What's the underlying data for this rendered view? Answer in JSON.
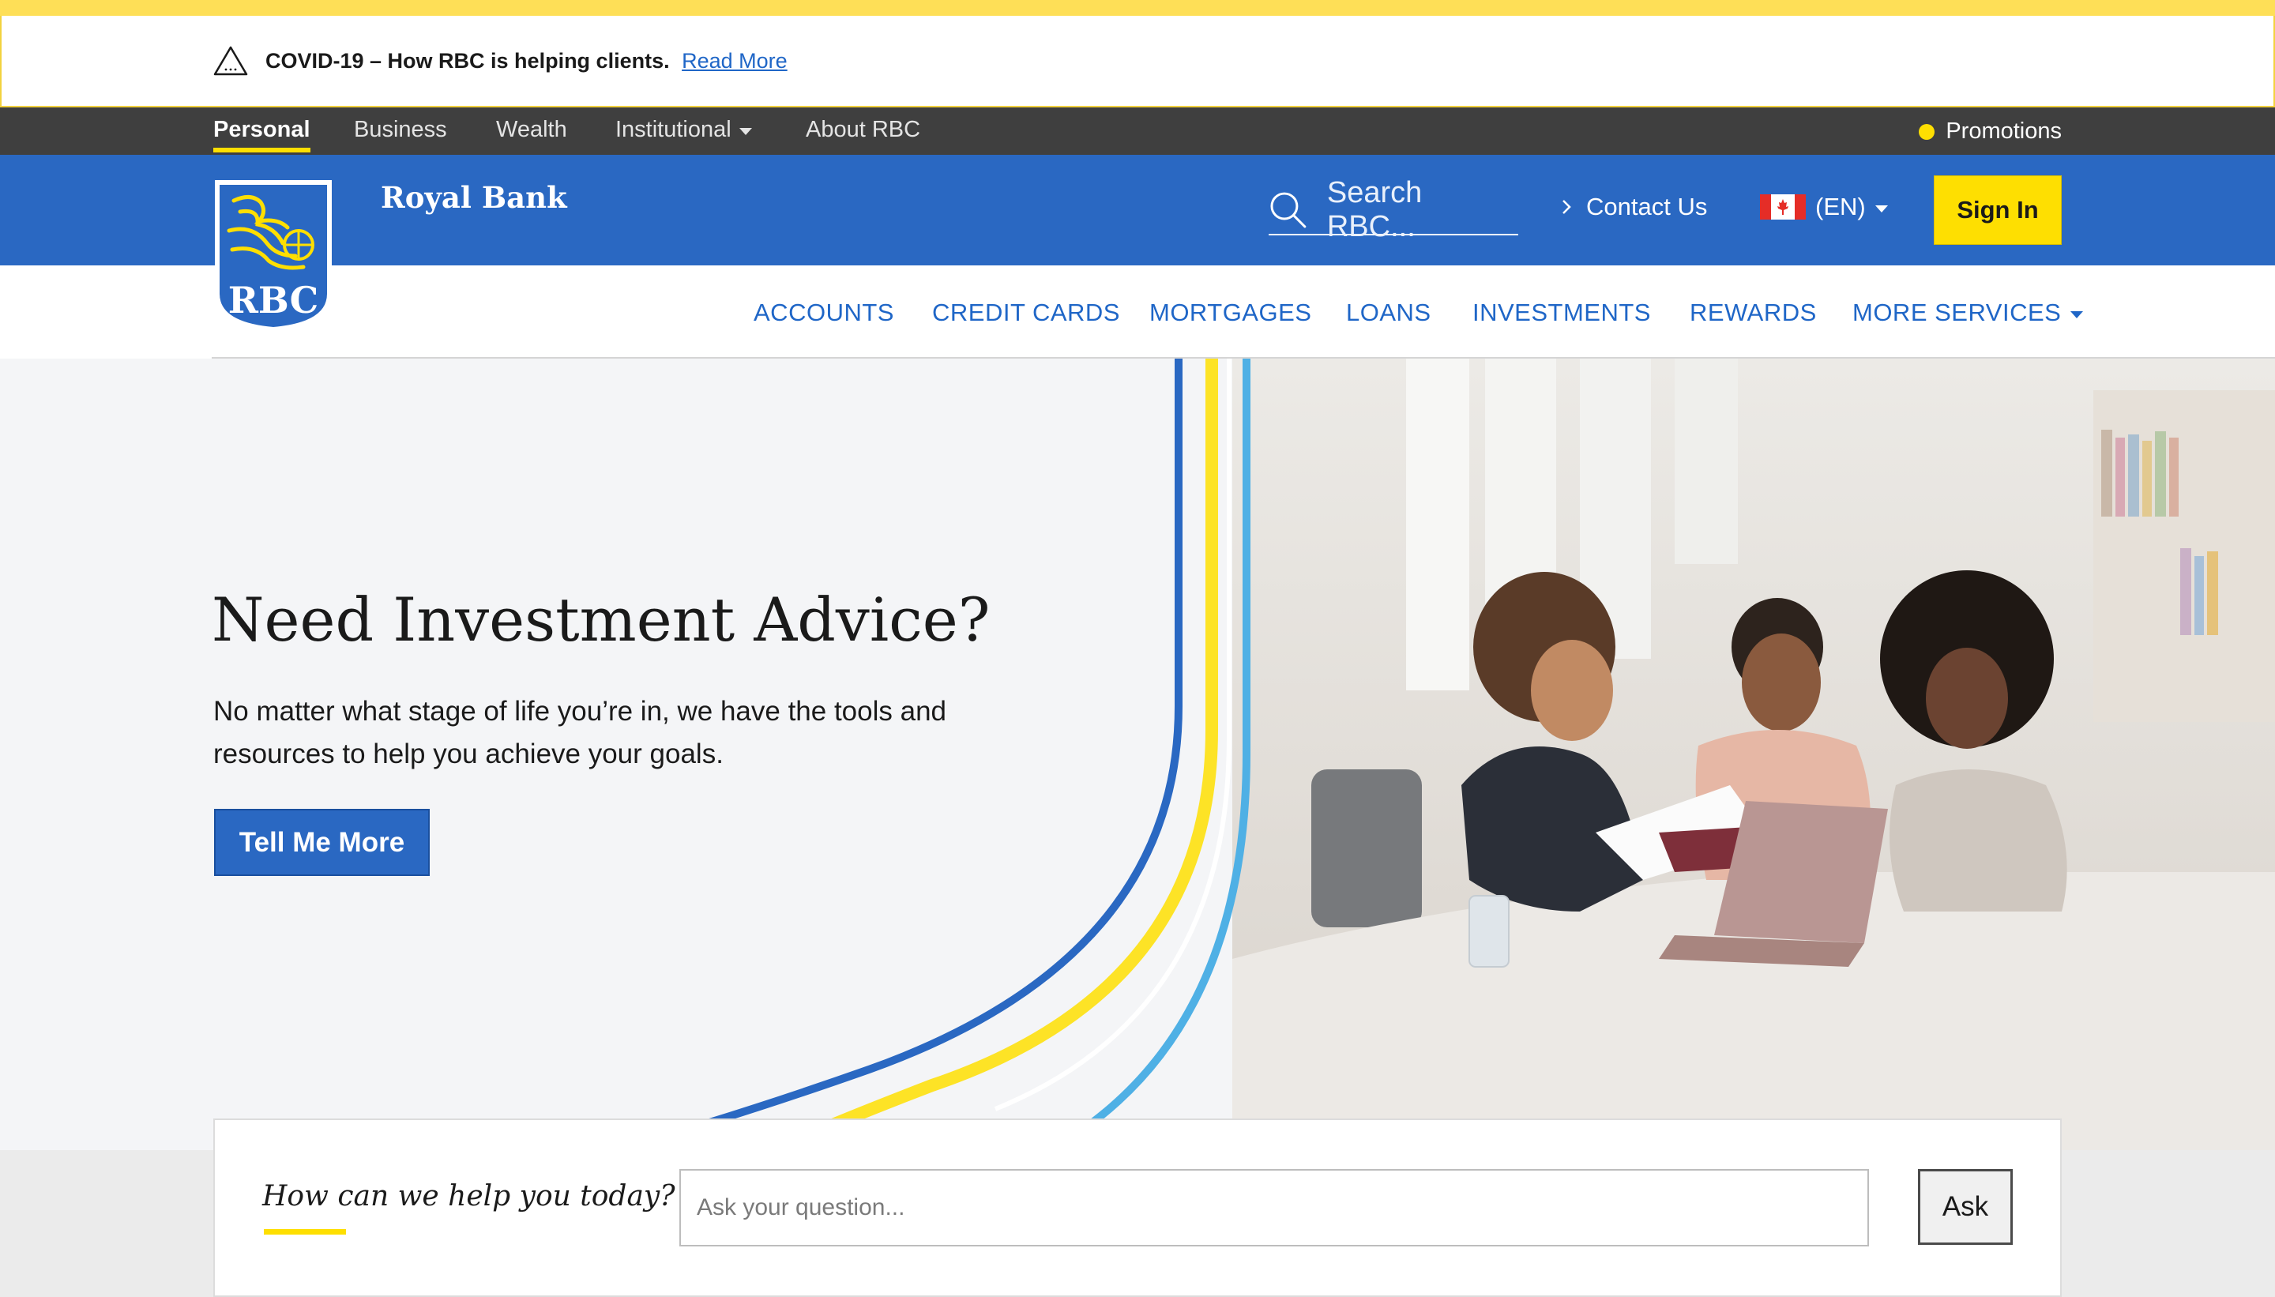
{
  "alert": {
    "message": "COVID-19 – How RBC is helping clients.",
    "link": "Read More",
    "icon": "warning-triangle-icon"
  },
  "segments": {
    "items": [
      "Personal",
      "Business",
      "Wealth",
      "Institutional",
      "About RBC"
    ],
    "active": "Personal",
    "promotions": "Promotions"
  },
  "header": {
    "brand": "Royal Bank",
    "logo_text": "RBC",
    "search_placeholder": "Search RBC...",
    "contact": "Contact Us",
    "language": "(EN)",
    "sign_in": "Sign In"
  },
  "nav": {
    "items": [
      "ACCOUNTS",
      "CREDIT CARDS",
      "MORTGAGES",
      "LOANS",
      "INVESTMENTS",
      "REWARDS",
      "MORE SERVICES"
    ]
  },
  "hero": {
    "title": "Need Investment Advice?",
    "subtitle_line1": "No matter what stage of life you’re in, we have the tools and",
    "subtitle_line2": "resources to help you achieve your goals.",
    "button": "Tell Me More"
  },
  "help": {
    "question": "How can we help you today?",
    "placeholder": "Ask your question...",
    "ask": "Ask"
  },
  "colors": {
    "rbc_blue": "#2a68c2",
    "rbc_yellow": "#fedf01",
    "segment_bar": "#3f3f3f",
    "link_blue": "#1f66c7"
  }
}
